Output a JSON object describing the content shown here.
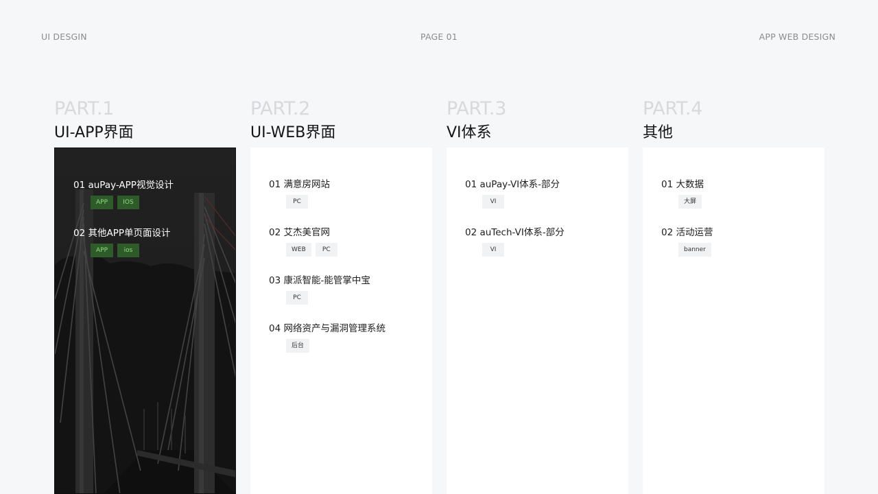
{
  "header": {
    "left": "UI DESGIN",
    "center": "PAGE 01",
    "right": "APP WEB DESIGN"
  },
  "columns": [
    {
      "part": "PART.1",
      "title": "UI-APP界面",
      "items": [
        {
          "title": "01 auPay-APP视觉设计",
          "tags": [
            "APP",
            "IOS"
          ]
        },
        {
          "title": "02 其他APP单页面设计",
          "tags": [
            "APP",
            "ios"
          ]
        }
      ]
    },
    {
      "part": "PART.2",
      "title": "UI-WEB界面",
      "items": [
        {
          "title": "01 满意房网站",
          "tags": [
            "PC"
          ]
        },
        {
          "title": "02 艾杰美官网",
          "tags": [
            "WEB",
            "PC"
          ]
        },
        {
          "title": "03 康派智能-能管掌中宝",
          "tags": [
            "PC"
          ]
        },
        {
          "title": "04 网络资产与漏洞管理系统",
          "tags": [
            "后台"
          ]
        }
      ]
    },
    {
      "part": "PART.3",
      "title": "VI体系",
      "items": [
        {
          "title": "01 auPay-VI体系-部分",
          "tags": [
            "VI"
          ]
        },
        {
          "title": "02 auTech-VI体系-部分",
          "tags": [
            "VI"
          ]
        }
      ]
    },
    {
      "part": "PART.4",
      "title": "其他",
      "items": [
        {
          "title": "01 大数据",
          "tags": [
            "大屏"
          ]
        },
        {
          "title": "02 活动运营",
          "tags": [
            "banner"
          ]
        }
      ]
    }
  ],
  "colors": {
    "background": "#f6f7f9",
    "dark_panel": "#2a2a2a",
    "tag_dark_bg": "#2f5a2a",
    "tag_dark_text": "#8ee07e",
    "tag_light_bg": "#f1f2f4"
  }
}
